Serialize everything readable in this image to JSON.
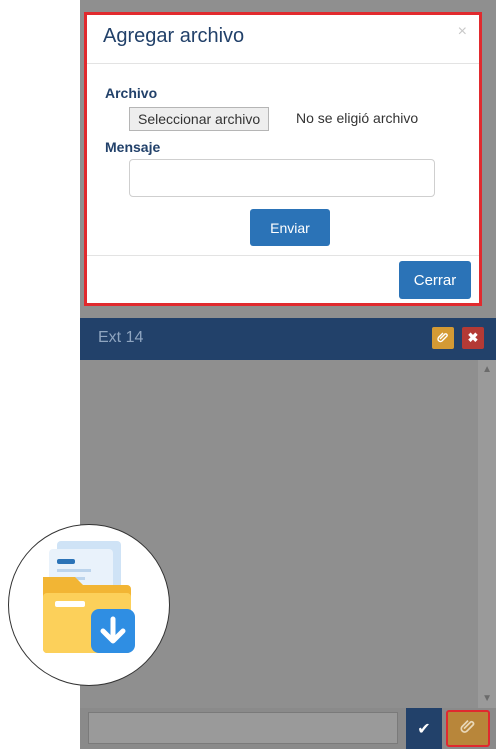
{
  "modal": {
    "title": "Agregar archivo",
    "close_x": "×",
    "file_label": "Archivo",
    "file_button": "Seleccionar archivo",
    "file_status": "No se eligió archivo",
    "message_label": "Mensaje",
    "message_value": "",
    "send_label": "Enviar",
    "close_label": "Cerrar"
  },
  "chat": {
    "title": "Ext 14",
    "input_value": ""
  },
  "icons": {
    "header_attach": "paperclip-icon",
    "header_close": "close-icon",
    "send": "check-icon",
    "attach": "paperclip-icon",
    "badge": "folder-download-icon"
  },
  "colors": {
    "header": "#22416a",
    "primary": "#2b73b7",
    "highlight": "#e12a2e",
    "attach": "#d49a34",
    "close": "#b43a35"
  }
}
